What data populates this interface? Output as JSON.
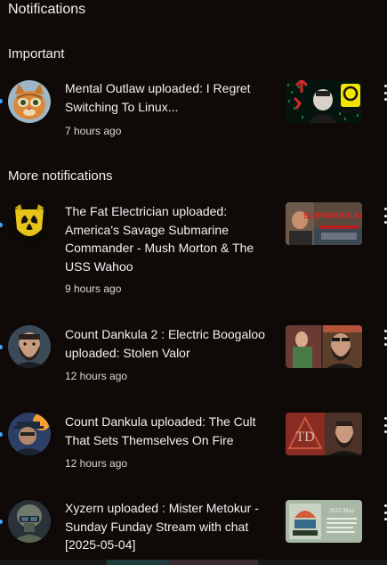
{
  "header": {
    "title": "Notifications"
  },
  "sections": {
    "important": {
      "title": "Important"
    },
    "more": {
      "title": "More notifications"
    }
  },
  "items": [
    {
      "text": "Mental Outlaw uploaded: I Regret Switching To Linux...",
      "time": "7 hours ago",
      "avatar_icon": "cat-avatar-icon",
      "thumb_text": "ATTLEFIE"
    },
    {
      "text": "The Fat Electrician uploaded: America's Savage Submarine Commander - Mush Morton & The USS Wahoo",
      "time": "9 hours ago",
      "avatar_icon": "radiation-shield-icon",
      "thumb_text": "SUBMARINE ACE"
    },
    {
      "text": "Count Dankula 2 : Electric Boogaloo uploaded: Stolen Valor",
      "time": "12 hours ago",
      "avatar_icon": "bearded-man-avatar-icon",
      "thumb_text": ""
    },
    {
      "text": "Count Dankula uploaded: The Cult That Sets Themselves On Fire",
      "time": "12 hours ago",
      "avatar_icon": "hat-avatar-icon",
      "thumb_text": "TD"
    },
    {
      "text": "Xyzern uploaded : Mister Metokur - Sunday Funday Stream with chat [2025-05-04]",
      "time": "",
      "avatar_icon": "soldier-helmet-avatar-icon",
      "thumb_text": "2025 May"
    }
  ],
  "colors": {
    "background": "#0f0a08",
    "unread_dot": "#3ea6ff",
    "text": "#f1f1f1"
  }
}
